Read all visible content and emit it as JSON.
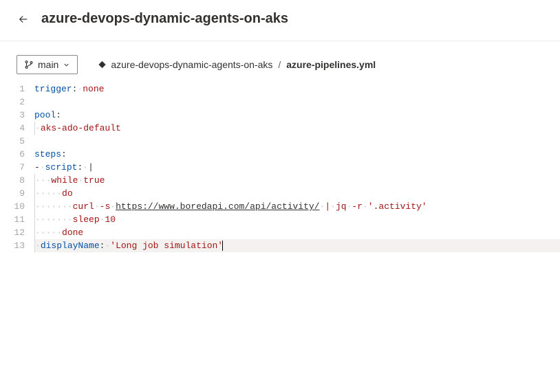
{
  "header": {
    "title": "azure-devops-dynamic-agents-on-aks"
  },
  "toolbar": {
    "branch_label": "main",
    "breadcrumb": {
      "repo": "azure-devops-dynamic-agents-on-aks",
      "file": "azure-pipelines.yml"
    }
  },
  "editor": {
    "line_numbers": [
      "1",
      "2",
      "3",
      "4",
      "5",
      "6",
      "7",
      "8",
      "9",
      "10",
      "11",
      "12",
      "13"
    ],
    "current_line": 13,
    "file_content_raw": "trigger: none\n\npool:\n  aks-ado-default\n\nsteps:\n- script: |\n    while true\n      do\n        curl -s https://www.boredapi.com/api/activity/ | jq -r '.activity'\n        sleep 10\n      done\n  displayName: 'Long job simulation'",
    "lines": [
      {
        "segments": [
          {
            "t": "trigger",
            "c": "key"
          },
          {
            "t": ":",
            "c": "plain"
          },
          {
            "t": " ",
            "c": "ws"
          },
          {
            "t": "none",
            "c": "val"
          }
        ]
      },
      {
        "segments": []
      },
      {
        "segments": [
          {
            "t": "pool",
            "c": "key"
          },
          {
            "t": ":",
            "c": "plain"
          }
        ]
      },
      {
        "indent": 2,
        "guide": true,
        "segments": [
          {
            "t": "aks-ado-default",
            "c": "val"
          }
        ]
      },
      {
        "segments": []
      },
      {
        "segments": [
          {
            "t": "steps",
            "c": "key"
          },
          {
            "t": ":",
            "c": "plain"
          }
        ]
      },
      {
        "segments": [
          {
            "t": "-",
            "c": "plain"
          },
          {
            "t": " ",
            "c": "ws"
          },
          {
            "t": "script",
            "c": "key"
          },
          {
            "t": ":",
            "c": "plain"
          },
          {
            "t": " ",
            "c": "ws"
          },
          {
            "t": "|",
            "c": "plain"
          }
        ]
      },
      {
        "indent": 4,
        "guide": true,
        "segments": [
          {
            "t": "while",
            "c": "val"
          },
          {
            "t": " ",
            "c": "ws"
          },
          {
            "t": "true",
            "c": "val"
          }
        ]
      },
      {
        "indent": 6,
        "guide": true,
        "segments": [
          {
            "t": "do",
            "c": "val"
          }
        ]
      },
      {
        "indent": 8,
        "guide": true,
        "segments": [
          {
            "t": "curl",
            "c": "val"
          },
          {
            "t": " ",
            "c": "ws"
          },
          {
            "t": "-s",
            "c": "val"
          },
          {
            "t": " ",
            "c": "ws"
          },
          {
            "t": "https://www.boredapi.com/api/activity/",
            "c": "url"
          },
          {
            "t": " ",
            "c": "ws"
          },
          {
            "t": "|",
            "c": "val"
          },
          {
            "t": " ",
            "c": "ws"
          },
          {
            "t": "jq",
            "c": "val"
          },
          {
            "t": " ",
            "c": "ws"
          },
          {
            "t": "-r",
            "c": "val"
          },
          {
            "t": " ",
            "c": "ws"
          },
          {
            "t": "'.activity'",
            "c": "str"
          }
        ]
      },
      {
        "indent": 8,
        "guide": true,
        "segments": [
          {
            "t": "sleep",
            "c": "val"
          },
          {
            "t": " ",
            "c": "ws"
          },
          {
            "t": "10",
            "c": "val"
          }
        ]
      },
      {
        "indent": 6,
        "guide": true,
        "segments": [
          {
            "t": "done",
            "c": "val"
          }
        ]
      },
      {
        "indent": 2,
        "guide": true,
        "current": true,
        "segments": [
          {
            "t": "displayName",
            "c": "key"
          },
          {
            "t": ":",
            "c": "plain"
          },
          {
            "t": " ",
            "c": "ws"
          },
          {
            "t": "'Long job simulation'",
            "c": "str"
          }
        ],
        "cursor_after": true
      }
    ]
  }
}
